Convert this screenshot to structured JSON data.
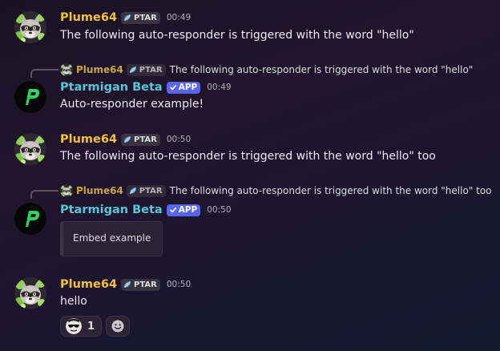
{
  "colors": {
    "background": "#1e152a",
    "plume_name": "#f0c23a",
    "ptarmigan_name": "#57c7d8",
    "app_badge": "#5865f2",
    "tag_background": "#3a3440"
  },
  "messages": [
    {
      "author": "Plume64",
      "tag": "PTAR",
      "tag_icon": "leaf-icon",
      "time": "00:49",
      "text": "The following auto-responder is triggered with the word \"hello\""
    },
    {
      "reply_to": {
        "author": "Plume64",
        "tag": "PTAR",
        "text": "The following auto-responder is triggered with the word \"hello\""
      },
      "author": "Ptarmigan Beta",
      "badge": "APP",
      "badge_icon": "checkmark-icon",
      "time": "00:49",
      "text": "Auto-responder example!"
    },
    {
      "author": "Plume64",
      "tag": "PTAR",
      "tag_icon": "leaf-icon",
      "time": "00:50",
      "text": "The following auto-responder is triggered with the word \"hello\" too"
    },
    {
      "reply_to": {
        "author": "Plume64",
        "tag": "PTAR",
        "text": "The following auto-responder is triggered with the word \"hello\" too"
      },
      "author": "Ptarmigan Beta",
      "badge": "APP",
      "badge_icon": "checkmark-icon",
      "time": "00:50",
      "embed_text": "Embed example"
    },
    {
      "author": "Plume64",
      "tag": "PTAR",
      "tag_icon": "leaf-icon",
      "time": "00:50",
      "text": "hello",
      "reactions": [
        {
          "emoji": "sunglasses-face-emoji",
          "count": "1"
        }
      ],
      "add_reaction_icon": "smiley-add-reaction-icon"
    }
  ]
}
